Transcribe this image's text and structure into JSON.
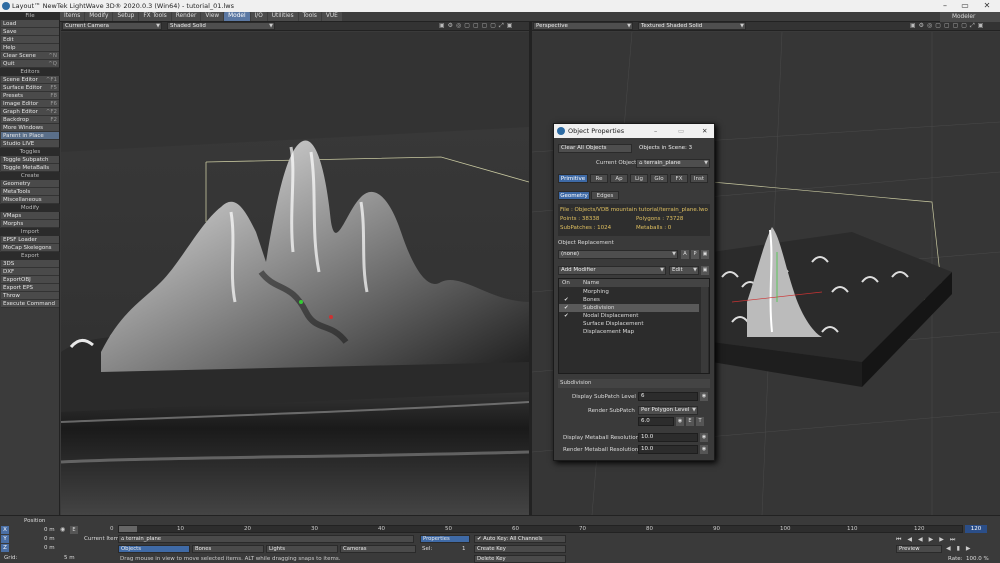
{
  "window": {
    "title": "Layout™ NewTek LightWave 3D® 2020.0.3 (Win64) - tutorial_01.lws"
  },
  "sidebar": {
    "file_head": "File",
    "file": [
      {
        "label": "Load"
      },
      {
        "label": "Save"
      },
      {
        "label": "Edit"
      },
      {
        "label": "Help"
      },
      {
        "label": "Clear Scene",
        "key": "^N"
      },
      {
        "label": "Quit",
        "key": "^Q"
      }
    ],
    "editors_head": "Editors",
    "editors": [
      {
        "label": "Scene Editor",
        "key": "^F1"
      },
      {
        "label": "Surface Editor",
        "key": "F5"
      },
      {
        "label": "Presets",
        "key": "F8"
      },
      {
        "label": "Image Editor",
        "key": "F6"
      },
      {
        "label": "Graph Editor",
        "key": "^F2"
      },
      {
        "label": "Backdrop",
        "key": "F2"
      },
      {
        "label": "More Windows"
      },
      {
        "label": "Parent in Place"
      },
      {
        "label": "Studio LIVE"
      }
    ],
    "toggles_head": "Toggles",
    "toggles": [
      {
        "label": "Toggle Subpatch"
      },
      {
        "label": "Toggle MetaBalls"
      }
    ],
    "create_head": "Create",
    "create": [
      {
        "label": "Geometry"
      },
      {
        "label": "MetaTools"
      },
      {
        "label": "Miscellaneous"
      }
    ],
    "modify_head": "Modify",
    "modify": [
      {
        "label": "VMaps"
      },
      {
        "label": "Morphs"
      }
    ],
    "import_head": "Import",
    "import": [
      {
        "label": "EPSF Loader"
      },
      {
        "label": "MoCap Skelegons"
      }
    ],
    "export_head": "Export",
    "export": [
      {
        "label": "3DS"
      },
      {
        "label": "DXF"
      },
      {
        "label": "ExportOBJ"
      },
      {
        "label": "Export EPS"
      },
      {
        "label": "Throw"
      },
      {
        "label": "Execute Command"
      }
    ]
  },
  "menubar": {
    "tabs": [
      "Items",
      "Modify",
      "Setup",
      "FX Tools",
      "Render",
      "View",
      "Model",
      "I/O",
      "Utilities",
      "Tools",
      "VUE"
    ],
    "active": "Model",
    "modeler": "Modeler"
  },
  "viewport_left": {
    "camera": "Current Camera",
    "shading": "Shaded Solid"
  },
  "viewport_right": {
    "view": "Perspective",
    "shading": "Textured Shaded Solid"
  },
  "dialog": {
    "title": "Object Properties",
    "clear_all": "Clear All Objects",
    "objects_in_scene": "Objects in Scene: 3",
    "current_object_label": "Current Object",
    "current_object": "terrain_plane",
    "tabs": [
      "Primitive",
      "Re",
      "Ap",
      "Lig",
      "Glo",
      "FX",
      "Inst"
    ],
    "subtabs": [
      "Geometry",
      "Edges"
    ],
    "file": "File : Objects/VDB mountain tutorial/terrain_plane.lwo",
    "points": "Points : 38338",
    "polygons": "Polygons : 73728",
    "subpatches": "SubPatches : 1024",
    "metaballs": "Metaballs : 0",
    "replacement_label": "Object Replacement",
    "replacement": "(none)",
    "add_modifier": "Add Modifier",
    "edit": "Edit",
    "list_cols": [
      "On",
      "Name"
    ],
    "modifiers": [
      {
        "on": "",
        "name": "Morphing"
      },
      {
        "on": "✔",
        "name": "Bones"
      },
      {
        "on": "✔",
        "name": "Subdivision"
      },
      {
        "on": "✔",
        "name": "Nodal Displacement"
      },
      {
        "on": "",
        "name": "Surface Displacement"
      },
      {
        "on": "",
        "name": "Displacement Map"
      }
    ],
    "subdivision_head": "Subdivision",
    "display_level_label": "Display SubPatch Level",
    "display_level": "6",
    "render_subpatch_label": "Render SubPatch",
    "render_subpatch": "Per Polygon Level",
    "render_value": "6.0",
    "disp_meta_label": "Display Metaball Resolution",
    "disp_meta": "10.0",
    "render_meta_label": "Render Metaball Resolution",
    "render_meta": "10.0"
  },
  "timeline": {
    "ticks": [
      "0",
      "10",
      "20",
      "30",
      "40",
      "50",
      "60",
      "70",
      "80",
      "90",
      "100",
      "110",
      "120"
    ],
    "end": "120",
    "position_label": "Position",
    "x": "0 m",
    "y": "0 m",
    "z": "0 m",
    "grid_label": "Grid:",
    "grid": "5 m",
    "current_item_label": "Current Item",
    "current_item": "terrain_plane",
    "objects": "Objects",
    "bones": "Bones",
    "lights": "Lights",
    "cameras": "Cameras",
    "properties": "Properties",
    "sel_label": "Sel:",
    "sel": "1",
    "autokey": "Auto Key: All Channels",
    "create_key": "Create Key",
    "delete_key": "Delete Key",
    "preview": "Preview",
    "rate_label": "Rate:",
    "rate": "100.0 %",
    "status": "Drag mouse in view to move selected items. ALT while dragging snaps to items."
  }
}
